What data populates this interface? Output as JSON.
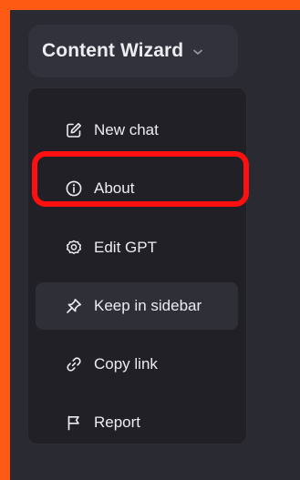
{
  "title": "Content Wizard",
  "menu": {
    "items": [
      {
        "label": "New chat",
        "icon": "pencil-square-icon"
      },
      {
        "label": "About",
        "icon": "info-icon"
      },
      {
        "label": "Edit GPT",
        "icon": "gear-icon"
      },
      {
        "label": "Keep in sidebar",
        "icon": "pin-icon"
      },
      {
        "label": "Copy link",
        "icon": "link-icon"
      },
      {
        "label": "Report",
        "icon": "flag-icon"
      }
    ]
  },
  "colors": {
    "outer_border": "#ff5a14",
    "background": "#2a2a33",
    "menu_background": "#202026",
    "hover_background": "#2f2f38",
    "highlight": "#ff1010",
    "text": "#ececf1"
  }
}
